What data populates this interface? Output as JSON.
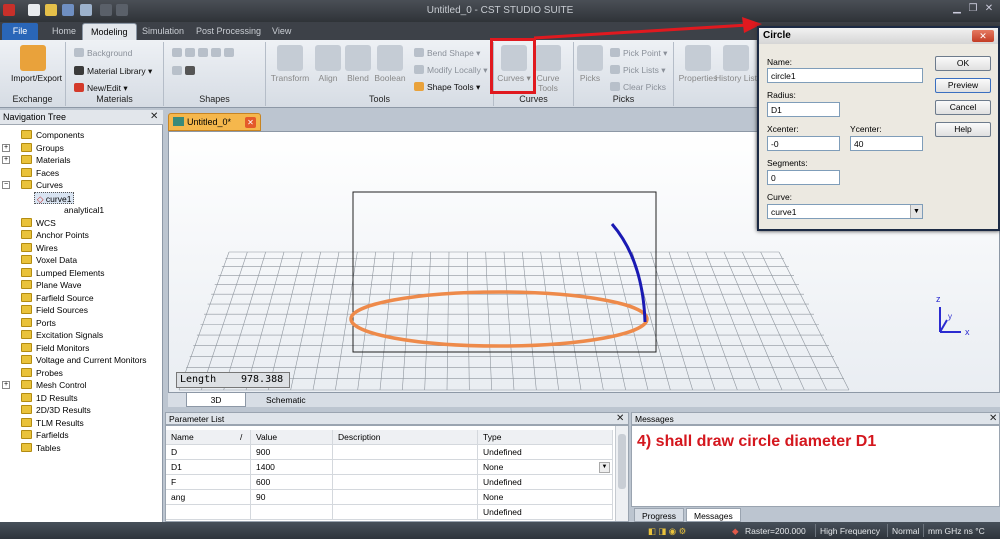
{
  "window": {
    "title": "Untitled_0 - CST STUDIO SUITE"
  },
  "menu_tabs": [
    "File",
    "Home",
    "Modeling",
    "Simulation",
    "Post Processing",
    "View"
  ],
  "ribbon": {
    "exchange": {
      "label": "Exchange",
      "import_export": "Import/Export"
    },
    "materials": {
      "label": "Materials",
      "background": "Background",
      "material_library": "Material Library",
      "new_edit": "New/Edit"
    },
    "shapes": {
      "label": "Shapes"
    },
    "tools": {
      "label": "Tools",
      "transform": "Transform",
      "align": "Align",
      "blend": "Blend",
      "boolean": "Boolean",
      "bend_shape": "Bend Shape",
      "modify_locally": "Modify Locally",
      "shape_tools": "Shape Tools"
    },
    "curves": {
      "label": "Curves",
      "curves": "Curves",
      "curve_tools": "Curve Tools"
    },
    "picks": {
      "label": "Picks",
      "picks": "Picks",
      "pick_point": "Pick Point",
      "pick_lists": "Pick Lists",
      "clear_picks": "Clear Picks"
    },
    "properties": "Properties",
    "history_list": "History List",
    "highlight_color": "#e0191f"
  },
  "navigation": {
    "title": "Navigation Tree",
    "items": [
      "Components",
      "Groups",
      "Materials",
      "Faces",
      "Curves",
      "curve1",
      "analytical1",
      "WCS",
      "Anchor Points",
      "Wires",
      "Voxel Data",
      "Lumped Elements",
      "Plane Wave",
      "Farfield Source",
      "Field Sources",
      "Ports",
      "Excitation Signals",
      "Field Monitors",
      "Voltage and Current Monitors",
      "Probes",
      "Mesh Control",
      "1D Results",
      "2D/3D Results",
      "TLM Results",
      "Farfields",
      "Tables"
    ]
  },
  "document": {
    "tab": "Untitled_0*"
  },
  "viewport": {
    "length_label": "Length",
    "length_value": "978.388",
    "tabs": [
      "3D",
      "Schematic"
    ],
    "circle_color": "#ee8a4a",
    "arc_color": "#1a1ab3"
  },
  "dialog": {
    "title": "Circle",
    "name_label": "Name:",
    "name_value": "circle1",
    "radius_label": "Radius:",
    "radius_value": "D1",
    "xcenter_label": "Xcenter:",
    "xcenter_value": "-0",
    "ycenter_label": "Ycenter:",
    "ycenter_value": "40",
    "segments_label": "Segments:",
    "segments_value": "0",
    "curve_label": "Curve:",
    "curve_value": "curve1",
    "ok": "OK",
    "preview": "Preview",
    "cancel": "Cancel",
    "help": "Help"
  },
  "parameter_list": {
    "title": "Parameter List",
    "columns": [
      "Name",
      "/",
      "Value",
      "Description",
      "Type"
    ],
    "rows": [
      {
        "name": "D",
        "value": "900",
        "description": "",
        "type": "Undefined"
      },
      {
        "name": "D1",
        "value": "1400",
        "description": "",
        "type": "None"
      },
      {
        "name": "F",
        "value": "600",
        "description": "",
        "type": "Undefined"
      },
      {
        "name": "ang",
        "value": "90",
        "description": "",
        "type": "None"
      },
      {
        "name": "",
        "value": "",
        "description": "",
        "type": "Undefined"
      }
    ]
  },
  "messages": {
    "title": "Messages",
    "text": "4) shall draw circle diameter D1",
    "tabs": [
      "Progress",
      "Messages"
    ]
  },
  "status": {
    "raster": "Raster=200.000",
    "mode": "High Frequency",
    "view": "Normal",
    "units": "mm GHz ns °C"
  }
}
